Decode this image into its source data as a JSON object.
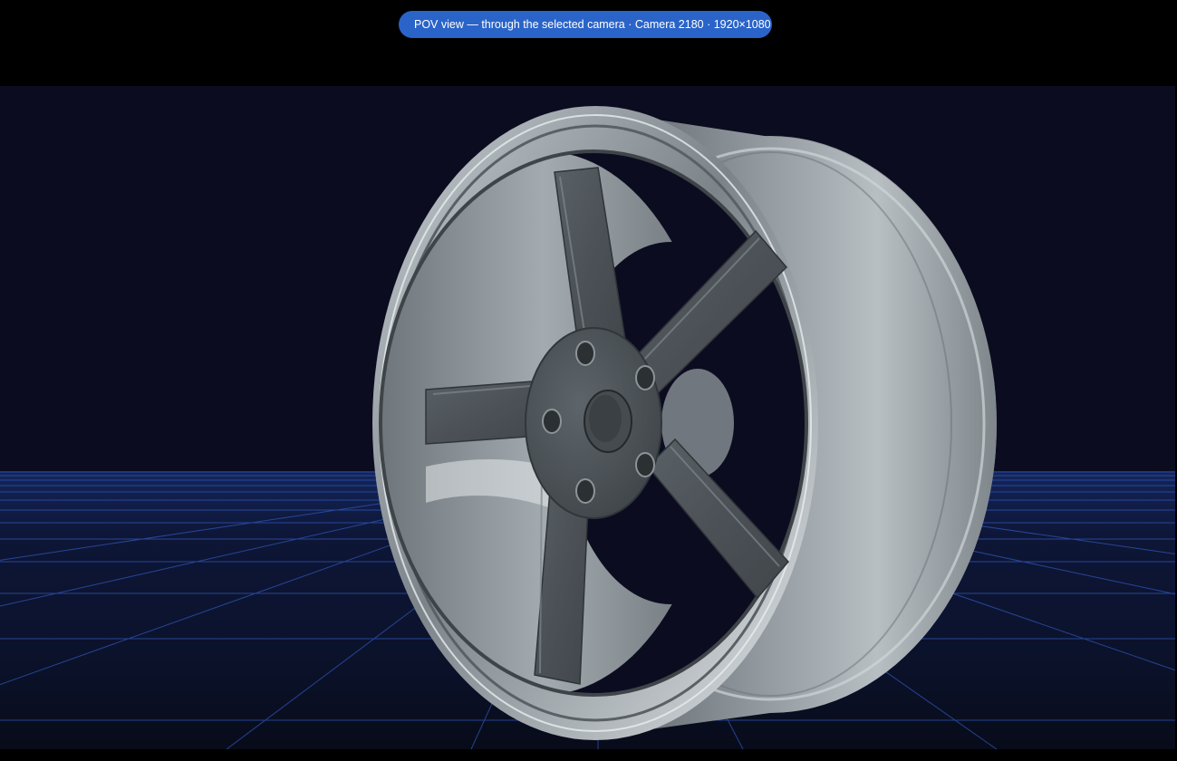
{
  "banner": {
    "text": "POV view — through the selected camera · Camera 2180 · 1920×1080"
  },
  "viewport": {
    "object": "wheel-rim",
    "floor": "grid"
  },
  "colors": {
    "background": "#0c0c20",
    "banner": "#2a64c9",
    "grid": "#2f56b8",
    "metal": "#9aa2a8"
  }
}
